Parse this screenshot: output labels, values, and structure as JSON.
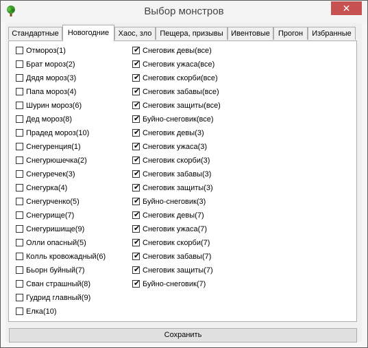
{
  "window": {
    "title": "Выбор монстров",
    "close_glyph": "✕",
    "icon": "tree-icon"
  },
  "tabs": [
    {
      "label": "Стандартные",
      "active": false
    },
    {
      "label": "Новогодние",
      "active": true
    },
    {
      "label": "Хаос, зло",
      "active": false
    },
    {
      "label": "Пещера, призывы",
      "active": false
    },
    {
      "label": "Ивентовые",
      "active": false
    },
    {
      "label": "Прогон",
      "active": false
    },
    {
      "label": "Избранные",
      "active": false
    }
  ],
  "left_column": [
    {
      "label": "Отмороз(1)",
      "checked": false
    },
    {
      "label": "Брат мороз(2)",
      "checked": false
    },
    {
      "label": "Дядя мороз(3)",
      "checked": false
    },
    {
      "label": "Папа мороз(4)",
      "checked": false
    },
    {
      "label": "Шурин мороз(6)",
      "checked": false
    },
    {
      "label": "Дед мороз(8)",
      "checked": false
    },
    {
      "label": "Прадед мороз(10)",
      "checked": false
    },
    {
      "label": "Снегуренция(1)",
      "checked": false
    },
    {
      "label": "Снегурюшечка(2)",
      "checked": false
    },
    {
      "label": "Снегуречек(3)",
      "checked": false
    },
    {
      "label": "Снегурка(4)",
      "checked": false
    },
    {
      "label": "Снегурченко(5)",
      "checked": false
    },
    {
      "label": "Снегурище(7)",
      "checked": false
    },
    {
      "label": "Снегуришище(9)",
      "checked": false
    },
    {
      "label": "Олли опасный(5)",
      "checked": false
    },
    {
      "label": "Колль кровожадный(6)",
      "checked": false
    },
    {
      "label": "Бьорн буйный(7)",
      "checked": false
    },
    {
      "label": "Сван страшный(8)",
      "checked": false
    },
    {
      "label": "Гудрид главный(9)",
      "checked": false
    },
    {
      "label": "Елка(10)",
      "checked": false
    }
  ],
  "right_column": [
    {
      "label": "Снеговик девы(все)",
      "checked": true
    },
    {
      "label": "Снеговик ужаса(все)",
      "checked": true
    },
    {
      "label": "Снеговик скорби(все)",
      "checked": true
    },
    {
      "label": "Снеговик забавы(все)",
      "checked": true
    },
    {
      "label": "Снеговик защиты(все)",
      "checked": true
    },
    {
      "label": "Буйно-снеговик(все)",
      "checked": true
    },
    {
      "label": "Снеговик девы(3)",
      "checked": true
    },
    {
      "label": "Снеговик ужаса(3)",
      "checked": true
    },
    {
      "label": "Снеговик скорби(3)",
      "checked": true
    },
    {
      "label": "Снеговик забавы(3)",
      "checked": true
    },
    {
      "label": "Снеговик защиты(3)",
      "checked": true
    },
    {
      "label": "Буйно-снеговик(3)",
      "checked": true
    },
    {
      "label": "Снеговик девы(7)",
      "checked": true
    },
    {
      "label": "Снеговик ужаса(7)",
      "checked": true
    },
    {
      "label": "Снеговик скорби(7)",
      "checked": true
    },
    {
      "label": "Снеговик забавы(7)",
      "checked": true
    },
    {
      "label": "Снеговик защиты(7)",
      "checked": true
    },
    {
      "label": "Буйно-снеговик(7)",
      "checked": true
    }
  ],
  "check_glyph": "✔",
  "save_label": "Сохранить"
}
